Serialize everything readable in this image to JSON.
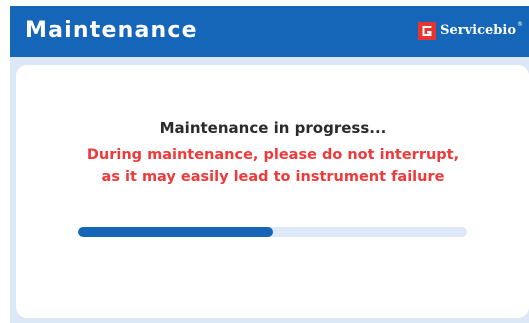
{
  "header": {
    "title": "Maintenance",
    "brand": {
      "name": "Servicebio",
      "registered_mark": "®",
      "logo_icon": "servicebio-g-logo-icon",
      "logo_color": "#e8342e"
    }
  },
  "main": {
    "status_text": "Maintenance in progress...",
    "warning_line_1": "During maintenance, please do not interrupt,",
    "warning_line_2": "as it may easily lead to instrument failure",
    "warning_color": "#f03a3a",
    "progress_fraction": 0.5,
    "progress_color": "#1565b8",
    "track_color": "#dde9f8"
  },
  "colors": {
    "header_bg": "#1565b8",
    "body_bg": "#dde8f6",
    "card_bg": "#ffffff"
  }
}
